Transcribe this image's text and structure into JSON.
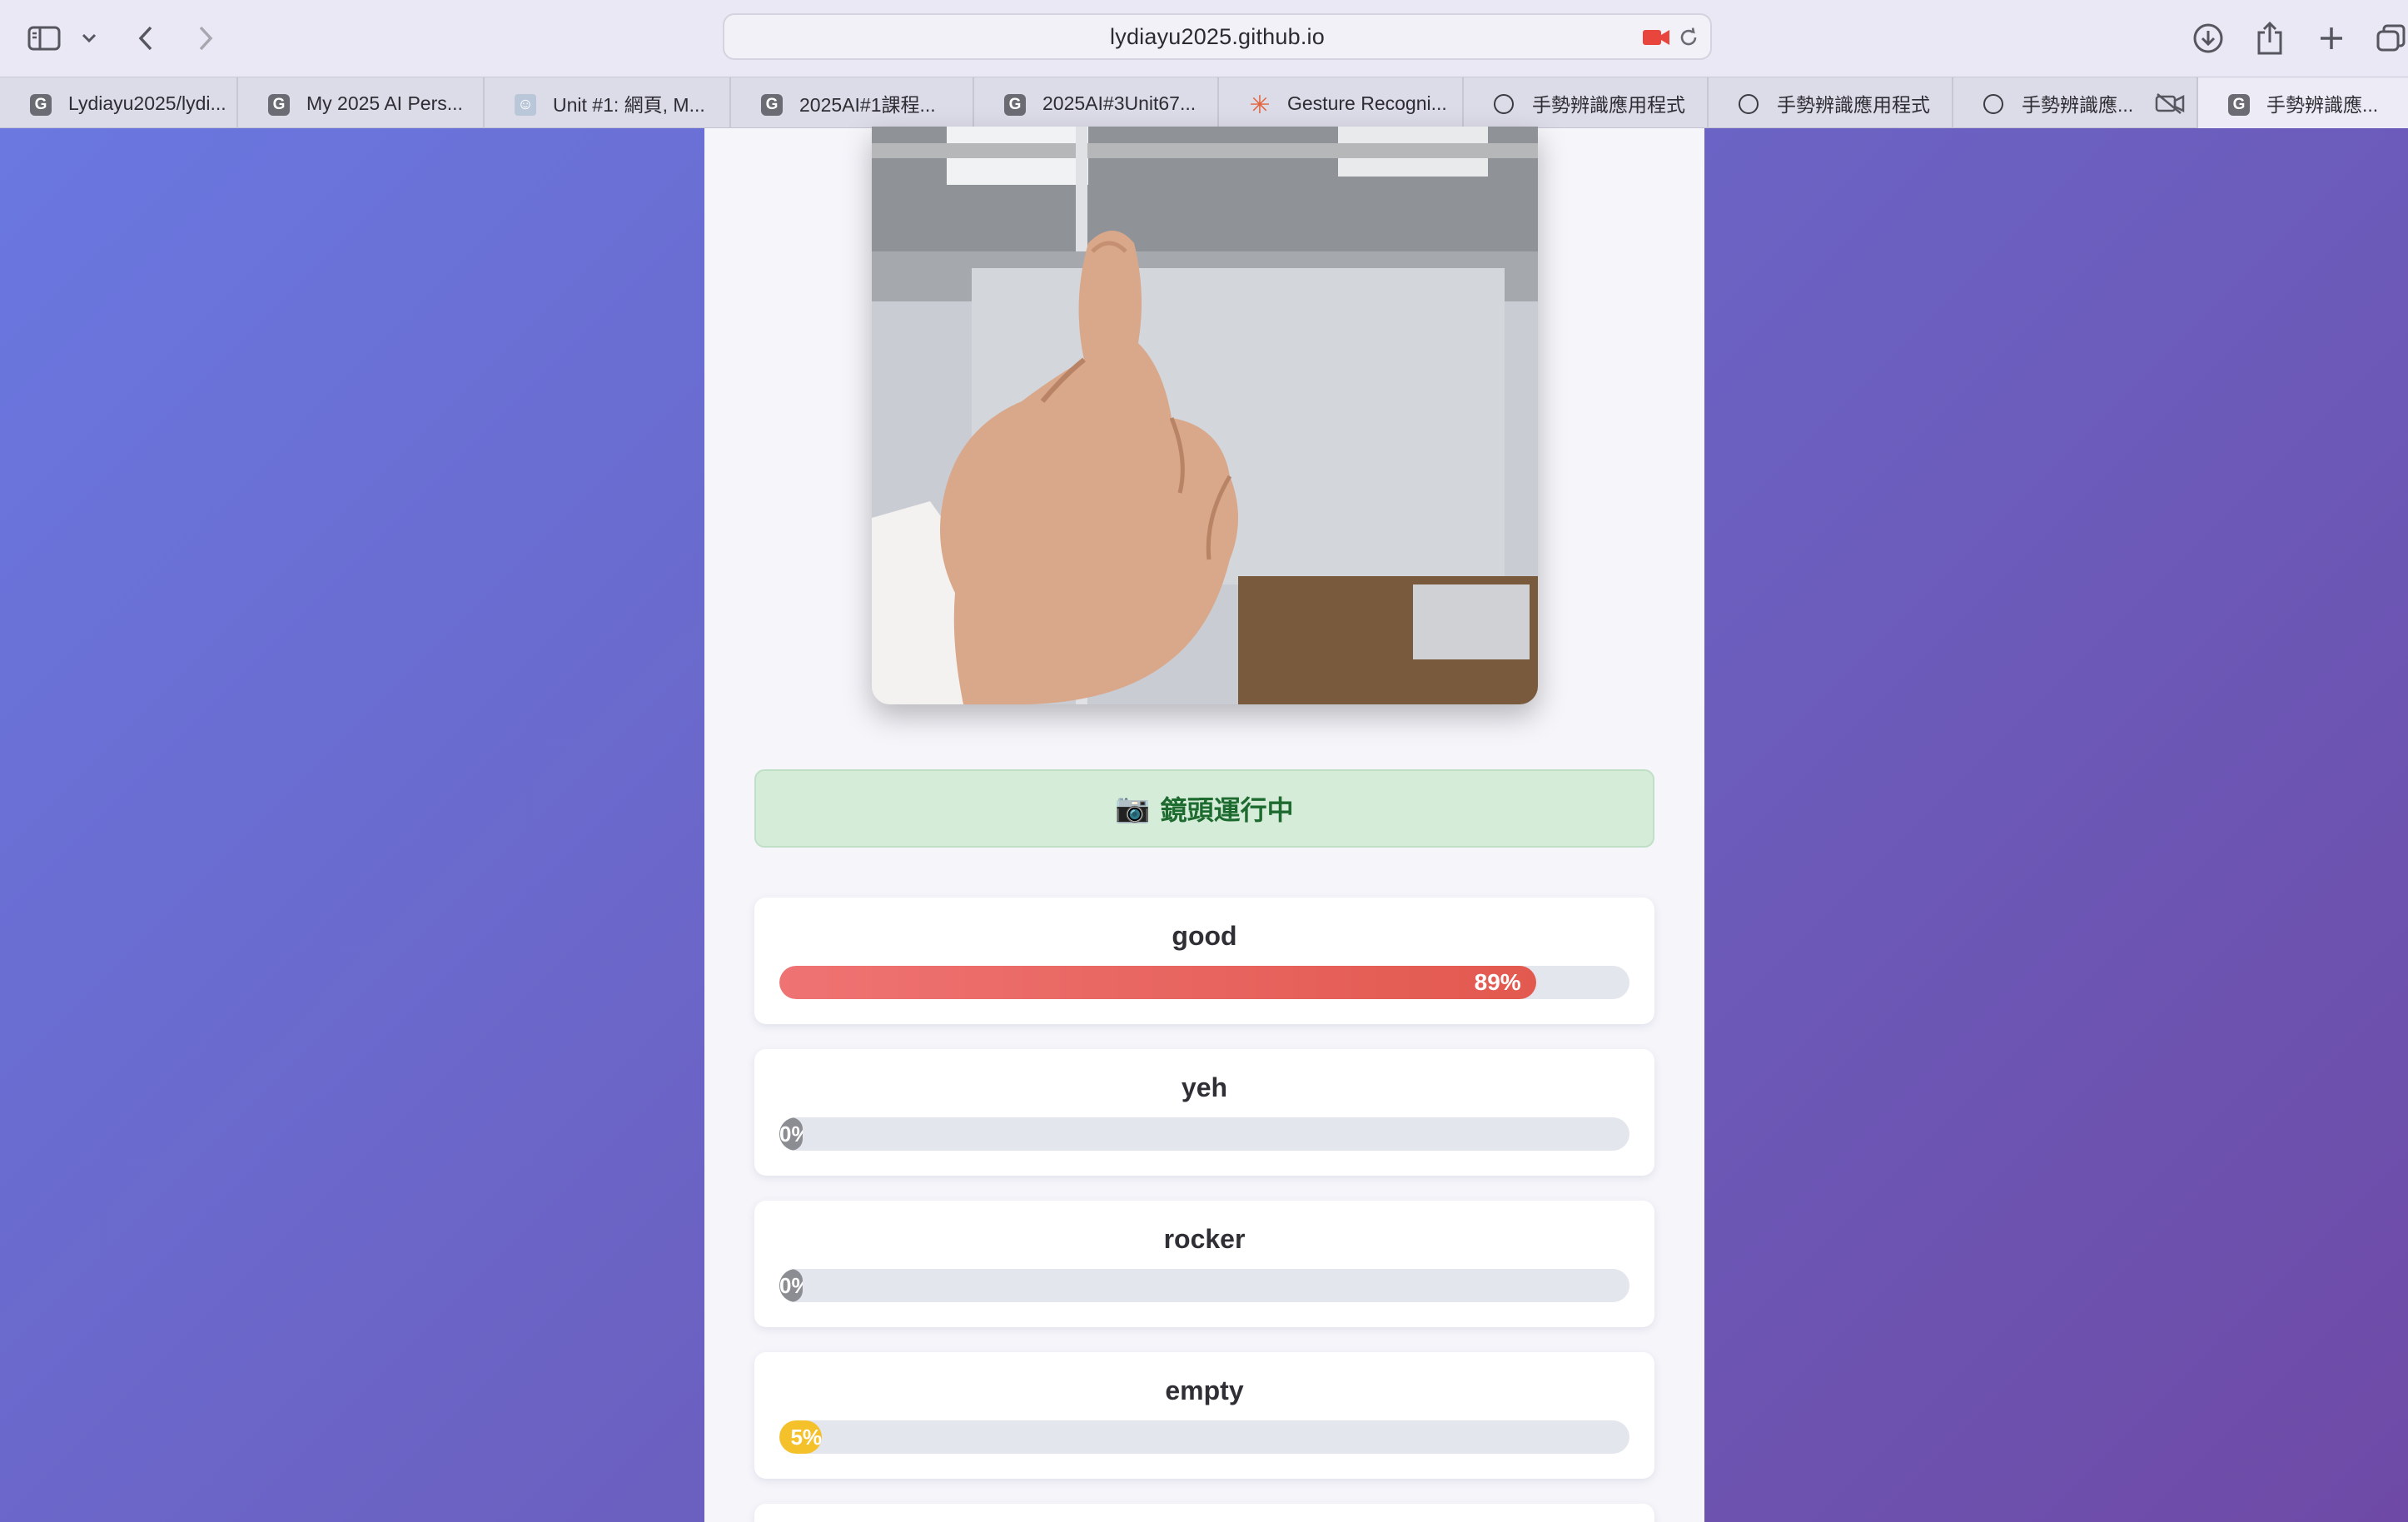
{
  "browser": {
    "url": "lydiayu2025.github.io",
    "tabs": [
      {
        "label": "Lydiayu2025/lydi...",
        "icon": "g-favicon-icon"
      },
      {
        "label": "My 2025 AI Pers...",
        "icon": "g-favicon-icon"
      },
      {
        "label": "Unit #1: 網頁, M...",
        "icon": "avatar-favicon-icon"
      },
      {
        "label": "2025AI#1課程...",
        "icon": "g-favicon-icon"
      },
      {
        "label": "2025AI#3Unit67...",
        "icon": "g-favicon-icon"
      },
      {
        "label": "Gesture Recogni...",
        "icon": "sparkle-favicon-icon"
      },
      {
        "label": "手勢辨識應用程式",
        "icon": "compass-icon"
      },
      {
        "label": "手勢辨識應用程式",
        "icon": "compass-icon"
      },
      {
        "label": "手勢辨識應...",
        "icon": "compass-icon"
      },
      {
        "label": "手勢辨識應...",
        "icon": "g-favicon-icon"
      }
    ]
  },
  "status": {
    "icon": "📷",
    "text": "鏡頭運行中"
  },
  "predictions": [
    {
      "name": "good",
      "percent": 89,
      "label": "89%",
      "color": "#e8625b"
    },
    {
      "name": "yeh",
      "percent": 0,
      "label": "0%",
      "color": "#8b8d92"
    },
    {
      "name": "rocker",
      "percent": 0,
      "label": "0%",
      "color": "#8b8d92"
    },
    {
      "name": "empty",
      "percent": 5,
      "label": "5%",
      "color": "#f5c12a"
    }
  ],
  "colors": {
    "background_start": "#6a78e0",
    "background_end": "#6e4aa6",
    "status_bg": "#d5ecd9",
    "status_text": "#1e6b30"
  }
}
